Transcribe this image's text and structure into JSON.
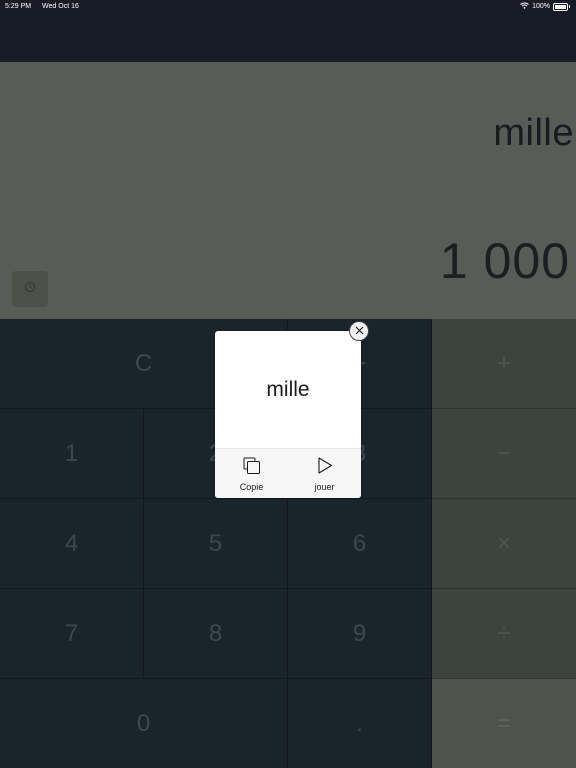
{
  "status_bar": {
    "time": "5:29 PM",
    "date": "Wed Oct 16",
    "battery": "100%",
    "wifi_icon": "wifi-icon"
  },
  "display": {
    "word": "mille",
    "number": "1 000",
    "history_icon": "clock-icon"
  },
  "keypad": {
    "clear": "C",
    "divide": "÷",
    "digits": [
      "0",
      "1",
      "2",
      "3",
      "4",
      "5",
      "6",
      "7",
      "8",
      "9"
    ],
    "decimal": ".",
    "plus": "+",
    "minus": "−",
    "multiply": "×",
    "equals": "="
  },
  "popup": {
    "word": "mille",
    "copy_label": "Copie",
    "play_label": "jouer",
    "close_icon": "close-icon"
  },
  "colors": {
    "display_bg": "#585b56",
    "keypad_bg": "#19242b",
    "operator_bg": "#3d433e",
    "popup_bg": "#ffffff"
  }
}
